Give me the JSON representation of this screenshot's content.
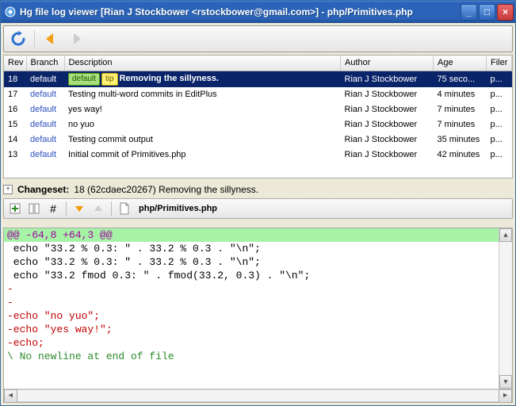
{
  "window": {
    "title": "Hg file log viewer [Rian J Stockbower <rstockbower@gmail.com>] - php/Primitives.php"
  },
  "columns": {
    "rev": "Rev",
    "branch": "Branch",
    "description": "Description",
    "author": "Author",
    "age": "Age",
    "filer": "Filer"
  },
  "rows": [
    {
      "rev": "18",
      "branch": "default",
      "badges": [
        "default",
        "tip"
      ],
      "desc": "Removing the sillyness.",
      "author": "Rian J Stockbower",
      "age": "75 seco...",
      "filer": "p...",
      "selected": true
    },
    {
      "rev": "17",
      "branch": "default",
      "badges": [],
      "desc": "Testing multi-word commits in EditPlus",
      "author": "Rian J Stockbower",
      "age": "4 minutes",
      "filer": "p..."
    },
    {
      "rev": "16",
      "branch": "default",
      "badges": [],
      "desc": "yes way!",
      "author": "Rian J Stockbower",
      "age": "7 minutes",
      "filer": "p..."
    },
    {
      "rev": "15",
      "branch": "default",
      "badges": [],
      "desc": "no yuo",
      "author": "Rian J Stockbower",
      "age": "7 minutes",
      "filer": "p..."
    },
    {
      "rev": "14",
      "branch": "default",
      "badges": [],
      "desc": "Testing commit output",
      "author": "Rian J Stockbower",
      "age": "35 minutes",
      "filer": "p..."
    },
    {
      "rev": "13",
      "branch": "default",
      "badges": [],
      "desc": "Initial commit of Primitives.php",
      "author": "Rian J Stockbower",
      "age": "42 minutes",
      "filer": "p..."
    }
  ],
  "changeset": {
    "label": "Changeset:",
    "text": "18 (62cdaec20267) Removing the sillyness."
  },
  "file_path": "php/Primitives.php",
  "diff": {
    "hunk": "@@ -64,8 +64,3 @@",
    "lines": [
      {
        "cls": "ctx",
        "t": " echo \"33.2 % 0.3: \" . 33.2 % 0.3 . \"\\n\";"
      },
      {
        "cls": "ctx",
        "t": " echo \"33.2 % 0.3: \" . 33.2 % 0.3 . \"\\n\";"
      },
      {
        "cls": "ctx",
        "t": " echo \"33.2 fmod 0.3: \" . fmod(33.2, 0.3) . \"\\n\";"
      },
      {
        "cls": "del",
        "t": "-"
      },
      {
        "cls": "del",
        "t": "-"
      },
      {
        "cls": "del",
        "t": "-echo \"no yuo\";"
      },
      {
        "cls": "del",
        "t": "-echo \"yes way!\";"
      },
      {
        "cls": "del",
        "t": "-echo;"
      },
      {
        "cls": "meta",
        "t": "\\ No newline at end of file"
      }
    ]
  }
}
